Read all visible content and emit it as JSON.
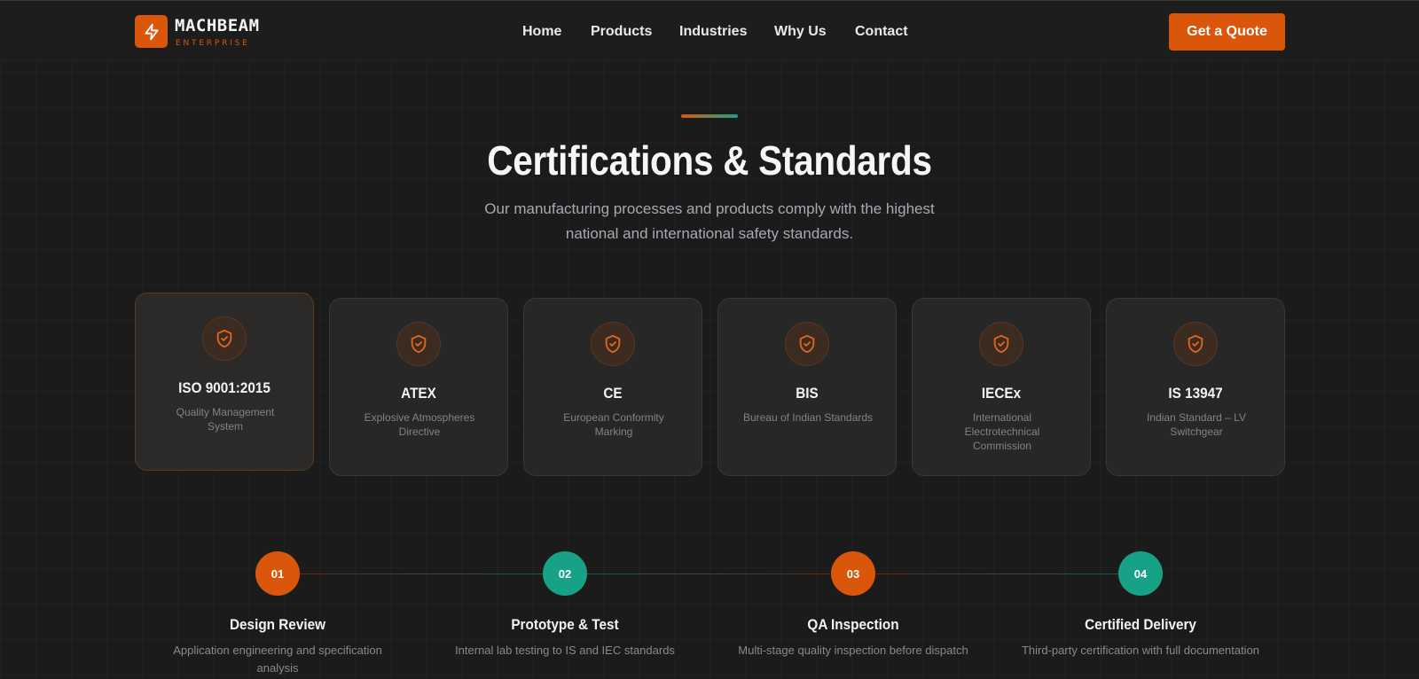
{
  "header": {
    "logo_name": "MACHBEAM",
    "logo_tagline": "ENTERPRISE",
    "logo_icon": "bolt-icon",
    "nav_items": [
      "Home",
      "Products",
      "Industries",
      "Why Us",
      "Contact"
    ],
    "cta_label": "Get a Quote"
  },
  "section": {
    "title": "Certifications & Standards",
    "subtitle_line1": "Our manufacturing processes and products comply with the highest",
    "subtitle_line2": "national and international safety standards."
  },
  "certifications": [
    {
      "title": "ISO 9001:2015",
      "desc": "Quality Management System",
      "icon": "shield-check-icon"
    },
    {
      "title": "ATEX",
      "desc": "Explosive Atmospheres Directive",
      "icon": "shield-check-icon"
    },
    {
      "title": "CE",
      "desc": "European Conformity Marking",
      "icon": "shield-check-icon"
    },
    {
      "title": "BIS",
      "desc": "Bureau of Indian Standards",
      "icon": "shield-check-icon"
    },
    {
      "title": "IECEx",
      "desc": "International Electrotechnical Commission",
      "icon": "shield-check-icon"
    },
    {
      "title": "IS 13947",
      "desc": "Indian Standard – LV Switchgear",
      "icon": "shield-check-icon"
    }
  ],
  "process_steps": [
    {
      "number": "01",
      "title": "Design Review",
      "desc": "Application engineering and specification analysis"
    },
    {
      "number": "02",
      "title": "Prototype & Test",
      "desc": "Internal lab testing to IS and IEC standards"
    },
    {
      "number": "03",
      "title": "QA Inspection",
      "desc": "Multi-stage quality inspection before dispatch"
    },
    {
      "number": "04",
      "title": "Certified Delivery",
      "desc": "Third-party certification with full documentation"
    }
  ],
  "colors": {
    "accent_orange": "#d9560a",
    "accent_teal": "#17a287",
    "background": "#1b1b1b",
    "card_background": "#272727"
  }
}
